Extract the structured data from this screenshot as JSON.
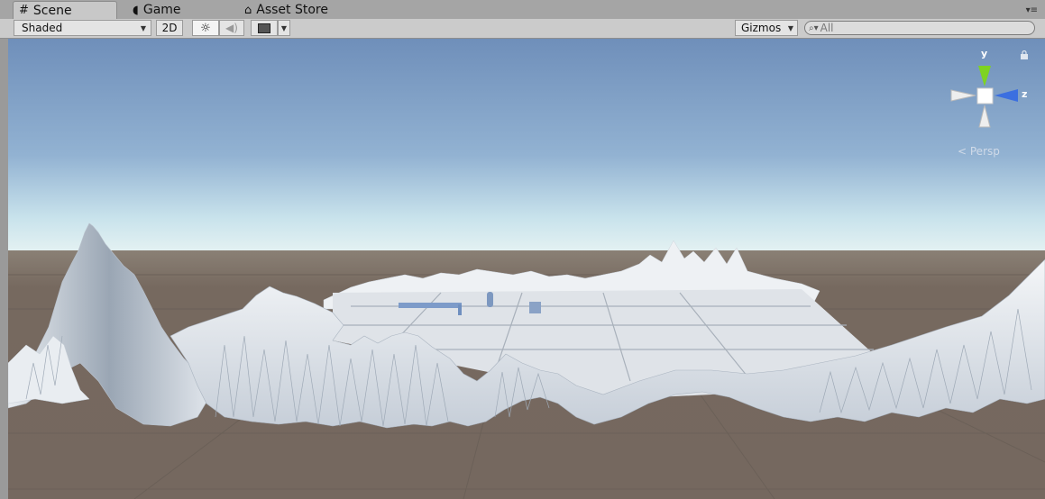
{
  "tabs": [
    {
      "label": "Scene",
      "icon": "grid-icon",
      "active": true
    },
    {
      "label": "Game",
      "icon": "pacman-icon",
      "active": false
    },
    {
      "label": "Asset Store",
      "icon": "bag-icon",
      "active": false
    }
  ],
  "toolbar": {
    "shading_mode": "Shaded",
    "mode_2d": "2D",
    "gizmos": "Gizmos",
    "search_value": "All"
  },
  "gizmo": {
    "axis_y": "y",
    "axis_z": "z",
    "projection": "Persp"
  },
  "colors": {
    "sky_top": "#6f8fba",
    "horizon": "#e3f1f2",
    "ground": "#76695f",
    "terrain": "#e8ecf0"
  }
}
